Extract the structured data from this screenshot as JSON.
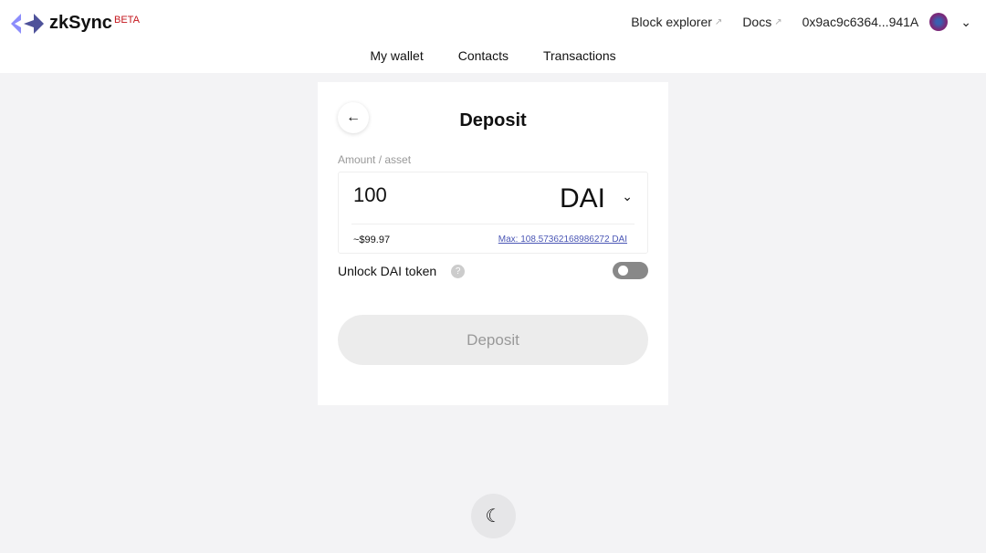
{
  "header": {
    "brand": "zkSync",
    "badge": "BETA",
    "links": [
      {
        "label": "Block explorer"
      },
      {
        "label": "Docs"
      }
    ],
    "address": "0x9ac9c6364...941A"
  },
  "nav": [
    {
      "label": "My wallet"
    },
    {
      "label": "Contacts"
    },
    {
      "label": "Transactions"
    }
  ],
  "deposit": {
    "title": "Deposit",
    "field_label": "Amount / asset",
    "amount": "100",
    "asset": "DAI",
    "usd": "~$99.97",
    "max": "Max: 108.57362168986272 DAI",
    "unlock_label": "Unlock DAI token",
    "help": "?",
    "unlock_enabled": false,
    "button": "Deposit"
  },
  "colors": {
    "accent": "#4e529a",
    "beta": "#c4161c"
  }
}
